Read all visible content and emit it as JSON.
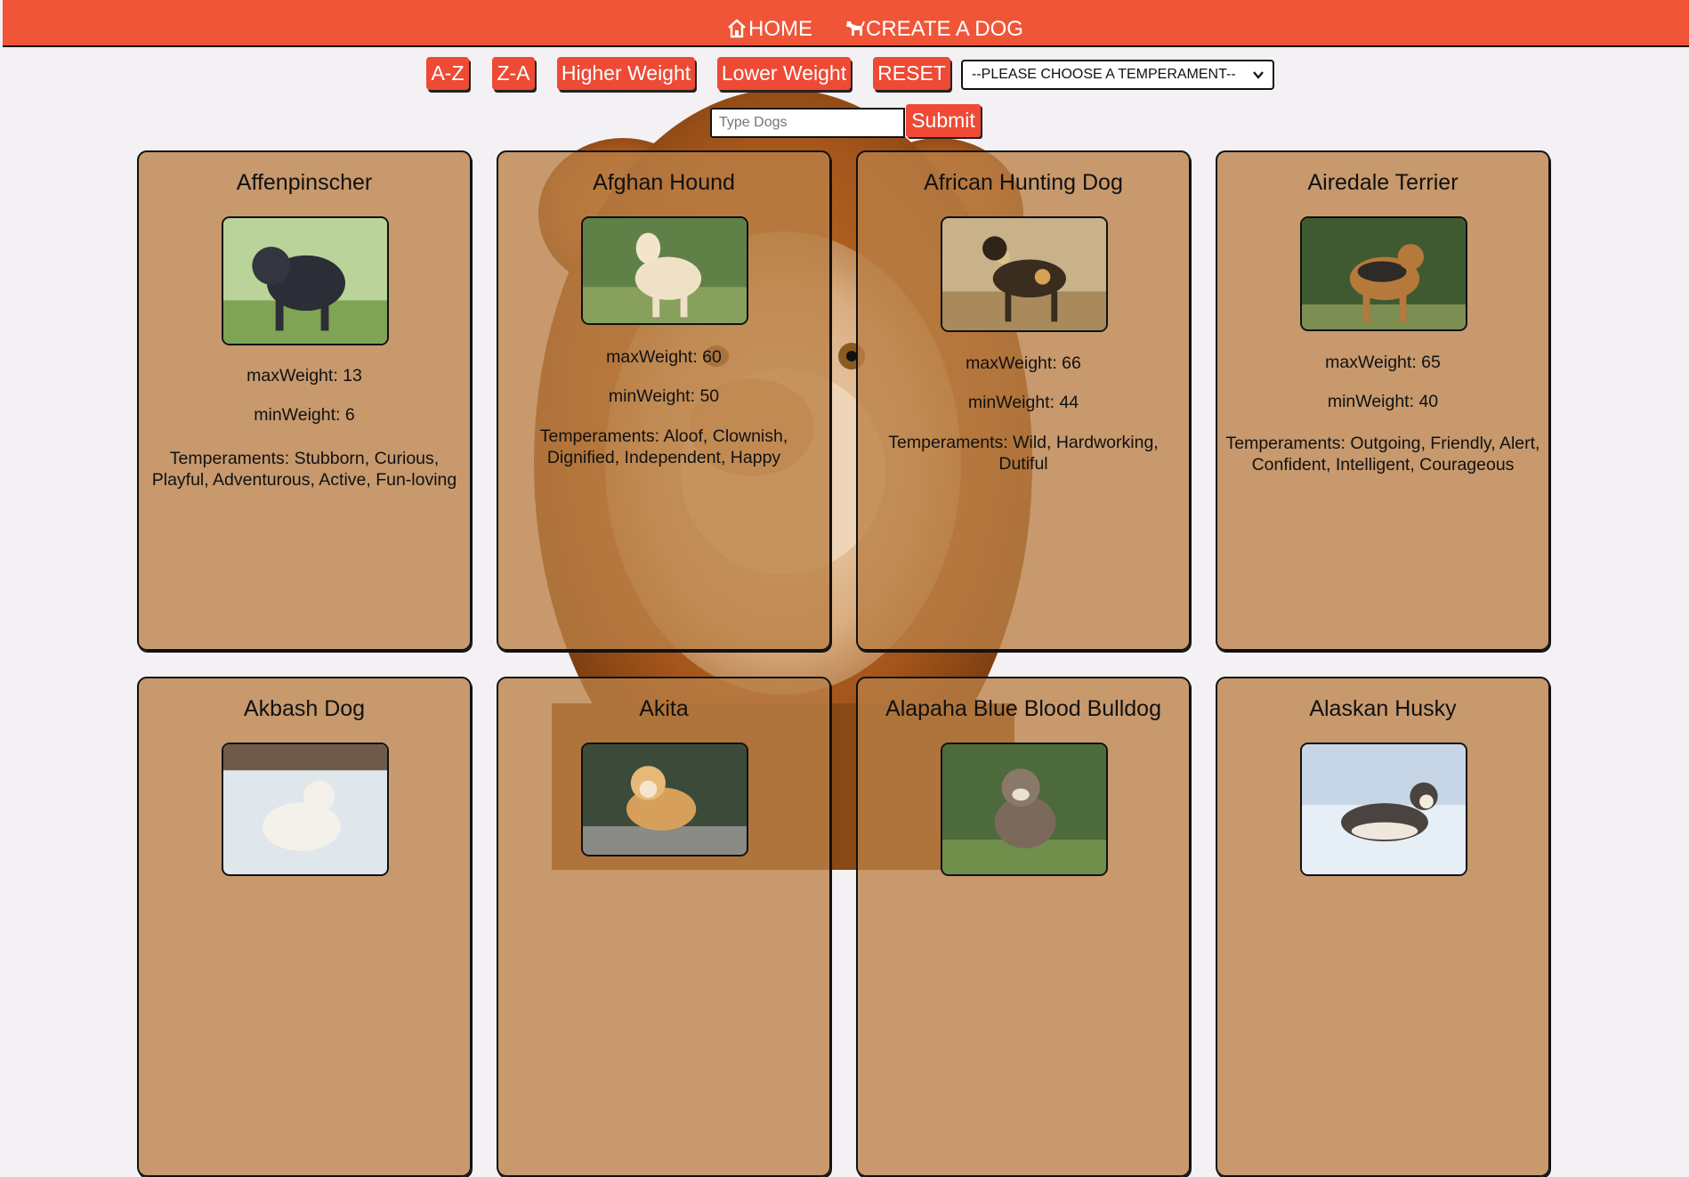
{
  "nav": {
    "home_label": "HOME",
    "create_label": "CREATE A DOG"
  },
  "sort_buttons": {
    "az": "A-Z",
    "za": "Z-A",
    "higher_weight": "Higher Weight",
    "lower_weight": "Lower Weight",
    "reset": "RESET"
  },
  "temperament_select": {
    "selected": "--PLEASE CHOOSE A TEMPERAMENT--"
  },
  "search": {
    "placeholder": "Type Dogs",
    "submit_label": "Submit"
  },
  "labels": {
    "max_weight": "maxWeight: ",
    "min_weight": "minWeight: ",
    "temperaments": "Temperaments: "
  },
  "colors": {
    "nav": "#f05537",
    "button": "#ee4a35",
    "card": "#ba8046"
  },
  "dogs": [
    {
      "name": "Affenpinscher",
      "max_weight": "13",
      "min_weight": "6",
      "temperaments": "Stubborn, Curious, Playful, Adventurous, Active, Fun-loving"
    },
    {
      "name": "Afghan Hound",
      "max_weight": "60",
      "min_weight": "50",
      "temperaments": "Aloof, Clownish, Dignified, Independent, Happy"
    },
    {
      "name": "African Hunting Dog",
      "max_weight": "66",
      "min_weight": "44",
      "temperaments": "Wild, Hardworking, Dutiful"
    },
    {
      "name": "Airedale Terrier",
      "max_weight": "65",
      "min_weight": "40",
      "temperaments": "Outgoing, Friendly, Alert, Confident, Intelligent, Courageous"
    },
    {
      "name": "Akbash Dog"
    },
    {
      "name": "Akita"
    },
    {
      "name": "Alapaha Blue Blood Bulldog"
    },
    {
      "name": "Alaskan Husky"
    }
  ]
}
